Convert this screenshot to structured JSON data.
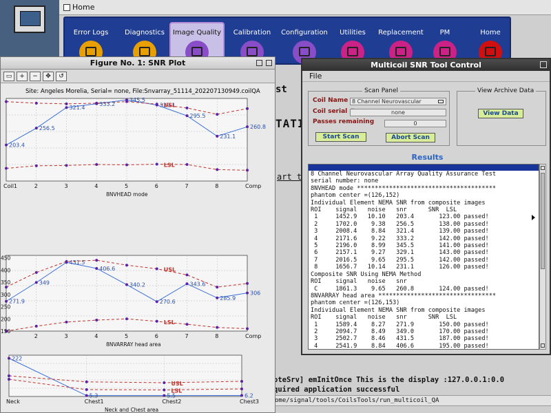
{
  "home": {
    "title": "Home",
    "tabs": [
      {
        "label": "Error Logs",
        "color": "#e8a000"
      },
      {
        "label": "Diagnostics",
        "color": "#e8a000"
      },
      {
        "label": "Image Quality",
        "color": "#8a4dc8",
        "selected": true
      },
      {
        "label": "Calibration",
        "color": "#8a4dc8"
      },
      {
        "label": "Configuration",
        "color": "#8a4dc8"
      },
      {
        "label": "Utilities",
        "color": "#cc2288"
      },
      {
        "label": "Replacement",
        "color": "#cc2288"
      },
      {
        "label": "PM",
        "color": "#cc2288"
      },
      {
        "label": "Home",
        "color": "#d01010"
      }
    ],
    "console": {
      "frag_st": "st",
      "frag_tati": "TATI",
      "frag_art": "art thi",
      "line1": "oteSrv] emInitOnce This is the display :127.0.0.1:0.0",
      "line2": "quired application successful",
      "path": "ome/signal/tools/CoilsTools/run_multicoil_QA"
    }
  },
  "figure": {
    "title": "Figure No. 1: SNR Plot",
    "tools": [
      "zoom-in",
      "zoom-out",
      "pan",
      "rotate"
    ],
    "site_line": "Site:  Angeles Morelia, Serial= none,  File:Snvarray_51114_202207130949.coilQA"
  },
  "chart_data": [
    {
      "type": "line",
      "xlabel": "8NVHEAD mode",
      "categories": [
        "Coil1",
        "2",
        "3",
        "4",
        "5",
        "6",
        "7",
        "8",
        "Comp"
      ],
      "series": [
        {
          "name": "snr",
          "values": [
            203.4,
            256.5,
            321.4,
            333.2,
            345.5,
            329.1,
            295.5,
            231.1,
            260.8
          ]
        },
        {
          "name": "USL",
          "values": [
            340,
            335,
            333,
            335,
            340,
            332,
            320,
            300,
            318
          ]
        },
        {
          "name": "LSL",
          "values": [
            130,
            138,
            139,
            142,
            141,
            143,
            142,
            126,
            124
          ]
        }
      ],
      "labels": {
        "snr": [
          "203.4",
          "256.5",
          "321.4",
          "333.2",
          "345.5",
          "329.1",
          "295.5",
          "231.1",
          "260.8"
        ],
        "USL": "USL",
        "LSL": "LSL"
      },
      "ylim": [
        90,
        350
      ]
    },
    {
      "type": "line",
      "xlabel": "8NVARRAY head area",
      "categories": [
        "2",
        "3",
        "4",
        "5",
        "6",
        "7",
        "8",
        "Comp"
      ],
      "series": [
        {
          "name": "snr",
          "values": [
            271.9,
            349.0,
            431.5,
            406.6,
            340.2,
            270.6,
            343.6,
            285.9,
            306
          ]
        },
        {
          "name": "USL",
          "values": [
            330,
            390,
            435,
            440,
            420,
            405,
            380,
            330,
            345
          ]
        },
        {
          "name": "LSL",
          "values": [
            150,
            170,
            187,
            195,
            200,
            190,
            178,
            165,
            160
          ]
        }
      ],
      "labels": {
        "snr": [
          "271.9",
          "349",
          "431.5",
          "406.6",
          "340.2",
          "270.6",
          "343.6",
          "285.9",
          "306"
        ],
        "USL": "USL",
        "LSL": "LSL"
      },
      "yticks": [
        "150",
        "200",
        "250",
        "300",
        "350",
        "400",
        "450"
      ],
      "ylim": [
        150,
        460
      ]
    },
    {
      "type": "line",
      "xlabel": "Neck and Chest area",
      "categories": [
        "Neck",
        "Chest1",
        "Chest2",
        "Chest3"
      ],
      "series": [
        {
          "name": "snr",
          "values": [
            222,
            5.3,
            5.5,
            6.2
          ]
        },
        {
          "name": "USL",
          "values": [
            120,
            85,
            80,
            88
          ]
        },
        {
          "name": "LSL",
          "values": [
            100,
            40,
            38,
            44
          ]
        }
      ],
      "labels": {
        "snr": [
          "222",
          "5.3",
          "5.5",
          "6.2"
        ],
        "USL": "USL",
        "LSL": "LSL"
      },
      "ylim": [
        0,
        240
      ]
    }
  ],
  "tool": {
    "title": "Multicoil SNR Tool Control",
    "menu_file": "File",
    "scan_panel_title": "Scan Panel",
    "coil_name_label": "Coil Name",
    "coil_name_value": "8 Channel Neurovascular",
    "coil_serial_label": "Coil serial #",
    "coil_serial_value": "none",
    "passes_label": "Passes remaining",
    "passes_value": "0",
    "start_scan": "Start Scan",
    "abort_scan": "Abort Scan",
    "archive_title": "View Archive Data",
    "view_data": "View Data",
    "results_title": "Results",
    "results_text": "8 Channel Neurovascular Array Quality Assurance Test\nserial number: none\n8NVHEAD mode ***************************************\nphantom center =(126,152)\nIndividual Element NEMA SNR from composite images\nROI    signal   noise   snr      SNR  LSL\n 1     1452.9   10.10   203.4       123.00 passed!\n 2     1702.0    9.38   256.5       138.00 passed!\n 3     2008.4    8.84   321.4       139.00 passed!\n 4     2171.6    9.22   333.2       142.00 passed!\n 5     2196.0    8.99   345.5       141.00 passed!\n 6     2157.1    9.27   329.1       143.00 passed!\n 7     2016.5    9.65   295.5       142.00 passed!\n 8     1656.7   10.14   231.1       126.00 passed!\nComposite SNR Using NEMA Method\nROI    signal   noise   snr\n C     1861.3    9.65   260.8       124.00 passed!\n8NVARRAY head area *********************************\nphantom center =(126,153)\nIndividual Element NEMA SNR from composite images\nROI    signal   noise   snr      SNR  LSL\n 1     1589.4    8.27   271.9       150.00 passed!\n 2     2094.7    8.49   349.0       170.00 passed!\n 3     2502.7    8.46   431.5       187.00 passed!\n 4     2541.9    8.84   406.6       195.00 passed!"
  },
  "colors": {
    "snr": "#3a6fd8",
    "limit": "#c0302a",
    "point": "#5a22a8"
  }
}
